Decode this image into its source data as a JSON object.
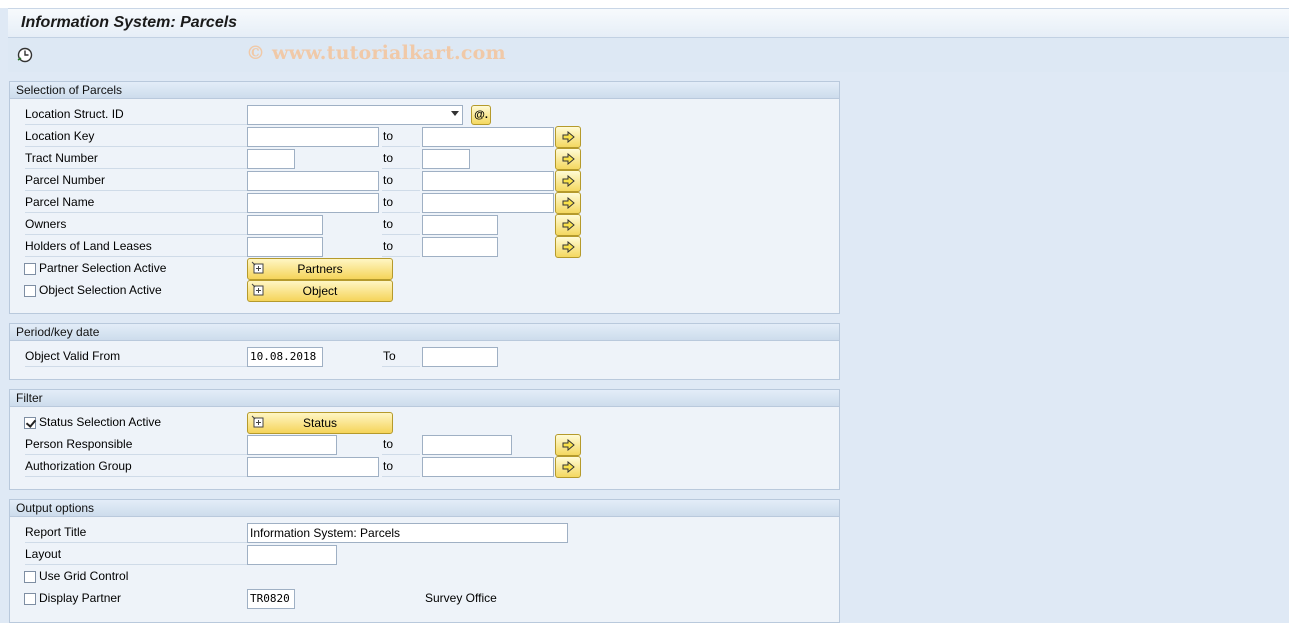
{
  "title": "Information System: Parcels",
  "watermark": "© www.tutorialkart.com",
  "toolbar": {
    "execute_icon": "execute-clock-icon"
  },
  "selection": {
    "header": "Selection of Parcels",
    "location_struct_label": "Location Struct. ID",
    "location_struct_value": "",
    "at_button_label": "@.",
    "location_key_label": "Location Key",
    "tract_number_label": "Tract Number",
    "parcel_number_label": "Parcel Number",
    "parcel_name_label": "Parcel Name",
    "owners_label": "Owners",
    "holders_label": "Holders of Land Leases",
    "to_label": "to",
    "partner_sel_label": "Partner Selection Active",
    "partner_sel_checked": false,
    "partners_button": "Partners",
    "object_sel_label": "Object Selection Active",
    "object_sel_checked": false,
    "object_button": "Object"
  },
  "period": {
    "header": "Period/key date",
    "valid_from_label": "Object Valid From",
    "valid_from_value": "10.08.2018",
    "to_label": "To",
    "to_value": ""
  },
  "filter": {
    "header": "Filter",
    "status_sel_label": "Status Selection Active",
    "status_sel_checked": true,
    "status_button": "Status",
    "person_label": "Person Responsible",
    "auth_label": "Authorization Group",
    "to_label": "to"
  },
  "output": {
    "header": "Output options",
    "report_title_label": "Report Title",
    "report_title_value": "Information System: Parcels",
    "layout_label": "Layout",
    "layout_value": "",
    "grid_label": "Use Grid Control",
    "grid_checked": false,
    "display_partner_label": "Display Partner",
    "display_partner_checked": false,
    "partner_value": "TR0820",
    "partner_desc": "Survey Office"
  },
  "colors": {
    "background": "#dfe9f5",
    "button": "#f5d45a",
    "group_header": "#cddcec"
  }
}
